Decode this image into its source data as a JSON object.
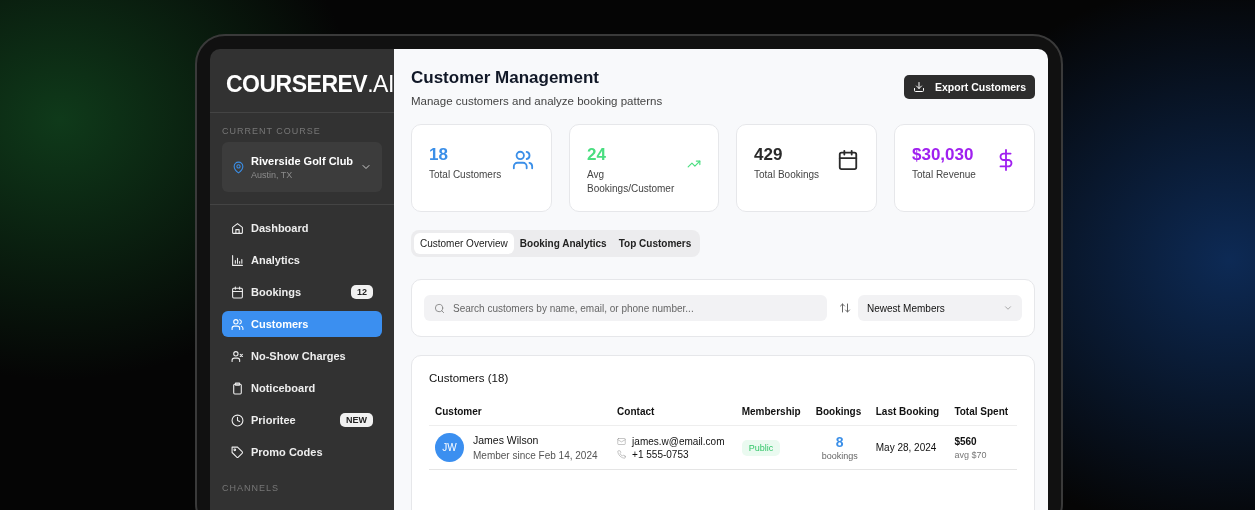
{
  "sidebar": {
    "logo": "**COURSEREV**.AI",
    "section_label": "CURRENT COURSE",
    "course": {
      "name": "Riverside Golf Club",
      "location": "Austin, TX"
    },
    "items": [
      {
        "label": "Dashboard",
        "selected": false
      },
      {
        "label": "Analytics",
        "selected": false
      },
      {
        "label": "Bookings",
        "selected": false,
        "badge": "12"
      },
      {
        "label": "Customers",
        "selected": true
      },
      {
        "label": "No-Show Charges",
        "selected": false
      },
      {
        "label": "Noticeboard",
        "selected": false
      },
      {
        "label": "Prioritee",
        "selected": false,
        "badge": "NEW"
      },
      {
        "label": "Promo Codes",
        "selected": false
      }
    ],
    "channels_label": "CHANNELS"
  },
  "header": {
    "title": "Customer Management",
    "subtitle": "Manage customers and analyze booking patterns",
    "export_button": "Export Customers"
  },
  "stats": [
    {
      "value": "18",
      "label": "Total Customers",
      "color": "#3b8fe8"
    },
    {
      "value": "24",
      "label": "Avg Bookings/Customer",
      "color": "#4ade80"
    },
    {
      "value": "429",
      "label": "Total Bookings",
      "color": "#2a2a2a"
    },
    {
      "value": "$30,030",
      "label": "Total Revenue",
      "color": "#a020f0"
    }
  ],
  "tabs": [
    {
      "label": "Customer Overview",
      "selected": true
    },
    {
      "label": "Booking Analytics",
      "selected": false
    },
    {
      "label": "Top Customers",
      "selected": false
    }
  ],
  "search": {
    "placeholder": "Search customers by name, email, or phone number...",
    "sort_value": "Newest Members"
  },
  "table": {
    "title": "Customers (18)",
    "columns": [
      "Customer",
      "Contact",
      "Membership",
      "Bookings",
      "Last Booking",
      "Total Spent"
    ],
    "rows": [
      {
        "initials": "JW",
        "name": "James Wilson",
        "member_since": "Member since Feb 14, 2024",
        "email": "james.w@email.com",
        "phone": "+1 555-0753",
        "membership": "Public",
        "bookings": "8",
        "bookings_unit": "bookings",
        "last_booking": "May 28, 2024",
        "total_spent": "$560",
        "avg": "avg $70"
      }
    ]
  }
}
